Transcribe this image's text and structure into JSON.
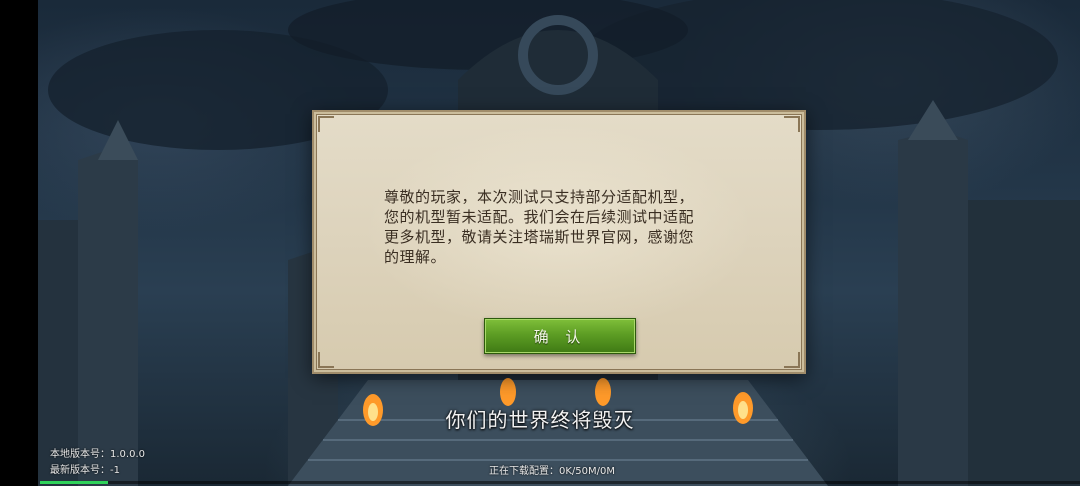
{
  "dialog": {
    "message": "尊敬的玩家，本次测试只支持部分适配机型，\n您的机型暂未适配。我们会在后续测试中适配\n更多机型，敬请关注塔瑞斯世界官网，感谢您\n的理解。",
    "confirm_label": "确 认"
  },
  "subtitle": "你们的世界终将毁灭",
  "version": {
    "local_label": "本地版本号：",
    "local_value": "1.0.0.0",
    "latest_label": "最新版本号：",
    "latest_value": "-1"
  },
  "download": {
    "status_text": "正在下载配置：0K/50M/0M",
    "progress_fraction": 0.065
  },
  "colors": {
    "accent_button": "#5d9d24",
    "progress": "#2fd25a",
    "dialog_bg": "#ddd3bc"
  }
}
